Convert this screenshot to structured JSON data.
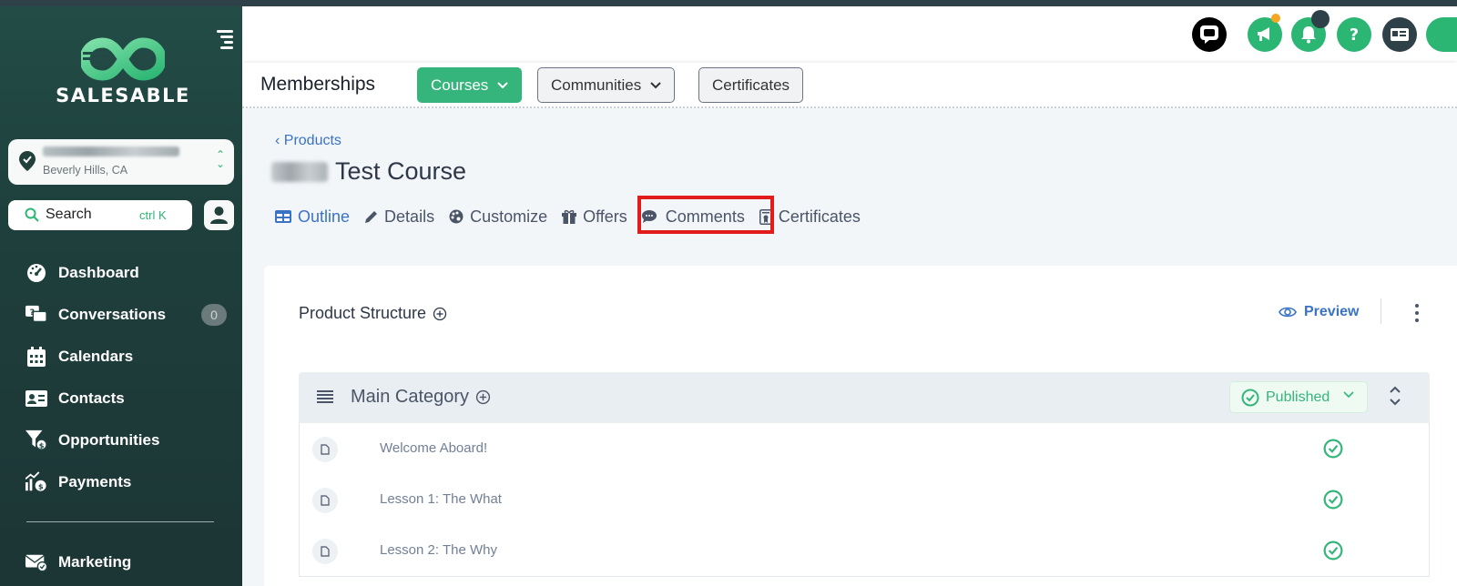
{
  "brand": {
    "name": "SALESABLE",
    "accent": "#35b57b",
    "sidebar_bg": "#214642"
  },
  "location": {
    "subtitle": "Beverly Hills, CA"
  },
  "search": {
    "label": "Search",
    "shortcut": "ctrl K"
  },
  "sidebar": {
    "items": [
      {
        "label": "Dashboard",
        "icon": "dashboard-gauge-icon"
      },
      {
        "label": "Conversations",
        "icon": "chat-bubbles-icon",
        "badge": "0"
      },
      {
        "label": "Calendars",
        "icon": "calendar-icon"
      },
      {
        "label": "Contacts",
        "icon": "contact-card-icon"
      },
      {
        "label": "Opportunities",
        "icon": "funnel-dollar-icon"
      },
      {
        "label": "Payments",
        "icon": "chart-dollar-icon"
      },
      {
        "label": "Marketing",
        "icon": "mail-check-icon"
      }
    ]
  },
  "header": {
    "icons": [
      "chat-widget-icon",
      "megaphone-icon",
      "bell-icon",
      "help-icon",
      "id-card-icon"
    ]
  },
  "subnav": {
    "title": "Memberships",
    "tabs": [
      {
        "label": "Courses",
        "dropdown": true,
        "active": true
      },
      {
        "label": "Communities",
        "dropdown": true,
        "active": false
      },
      {
        "label": "Certificates",
        "dropdown": false,
        "active": false
      }
    ]
  },
  "course": {
    "back_label": "Products",
    "title": "Test Course",
    "tabs": [
      {
        "label": "Outline",
        "icon": "table-icon",
        "active": true
      },
      {
        "label": "Details",
        "icon": "pencil-icon",
        "active": false
      },
      {
        "label": "Customize",
        "icon": "palette-icon",
        "active": false
      },
      {
        "label": "Offers",
        "icon": "gift-icon",
        "active": false
      },
      {
        "label": "Comments",
        "icon": "comment-icon",
        "active": false
      },
      {
        "label": "Certificates",
        "icon": "certificate-icon",
        "active": false
      }
    ]
  },
  "structure": {
    "title": "Product Structure",
    "preview_label": "Preview",
    "category": {
      "name": "Main Category",
      "status": "Published"
    },
    "lessons": [
      {
        "name": "Welcome Aboard!",
        "published": true
      },
      {
        "name": "Lesson 1: The What",
        "published": true
      },
      {
        "name": "Lesson 2: The Why",
        "published": true
      }
    ]
  }
}
